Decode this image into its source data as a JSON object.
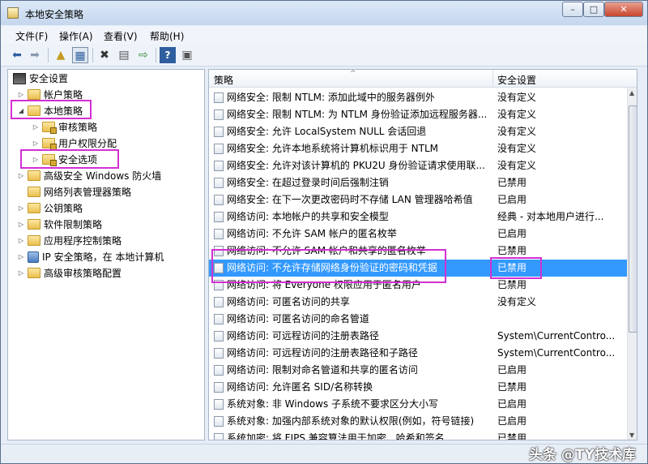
{
  "window": {
    "title": "本地安全策略",
    "min_label": "–",
    "max_label": "□",
    "close_label": "✕"
  },
  "menu": [
    {
      "label": "文件(F)"
    },
    {
      "label": "操作(A)"
    },
    {
      "label": "查看(V)"
    },
    {
      "label": "帮助(H)"
    }
  ],
  "toolbar": [
    "back-icon",
    "forward-icon",
    "up-folder-icon",
    "show-hide-tree-icon",
    "delete-icon",
    "properties-icon",
    "export-list-icon",
    "help-icon",
    "console-icon"
  ],
  "tree": {
    "root": "安全设置",
    "items": [
      {
        "label": "帐户策略"
      },
      {
        "label": "本地策略"
      },
      {
        "label": "审核策略"
      },
      {
        "label": "用户权限分配"
      },
      {
        "label": "安全选项"
      },
      {
        "label": "高级安全 Windows 防火墙"
      },
      {
        "label": "网络列表管理器策略"
      },
      {
        "label": "公钥策略"
      },
      {
        "label": "软件限制策略"
      },
      {
        "label": "应用程序控制策略"
      },
      {
        "label": "IP 安全策略，在 本地计算机"
      },
      {
        "label": "高级审核策略配置"
      }
    ]
  },
  "table": {
    "col_policy": "策略",
    "col_setting": "安全设置",
    "rows": [
      {
        "policy": "网络安全: 限制 NTLM: 添加此域中的服务器例外",
        "setting": "没有定义"
      },
      {
        "policy": "网络安全: 限制 NTLM: 为 NTLM 身份验证添加远程服务器...",
        "setting": "没有定义"
      },
      {
        "policy": "网络安全: 允许 LocalSystem NULL 会话回退",
        "setting": "没有定义"
      },
      {
        "policy": "网络安全: 允许本地系统将计算机标识用于 NTLM",
        "setting": "没有定义"
      },
      {
        "policy": "网络安全: 允许对该计算机的 PKU2U 身份验证请求使用联...",
        "setting": "没有定义"
      },
      {
        "policy": "网络安全: 在超过登录时间后强制注销",
        "setting": "已禁用"
      },
      {
        "policy": "网络安全: 在下一次更改密码时不存储 LAN 管理器哈希值",
        "setting": "已启用"
      },
      {
        "policy": "网络访问: 本地帐户的共享和安全模型",
        "setting": "经典 - 对本地用户进行..."
      },
      {
        "policy": "网络访问: 不允许 SAM 帐户的匿名枚举",
        "setting": "已启用"
      },
      {
        "policy": "网络访问: 不允许 SAM 帐户和共享的匿名枚举",
        "setting": "已禁用"
      },
      {
        "policy": "网络访问: 不允许存储网络身份验证的密码和凭据",
        "setting": "已禁用"
      },
      {
        "policy": "网络访问: 将 Everyone 权限应用于匿名用户",
        "setting": "已禁用"
      },
      {
        "policy": "网络访问: 可匿名访问的共享",
        "setting": "没有定义"
      },
      {
        "policy": "网络访问: 可匿名访问的命名管道",
        "setting": ""
      },
      {
        "policy": "网络访问: 可远程访问的注册表路径",
        "setting": "System\\CurrentContro..."
      },
      {
        "policy": "网络访问: 可远程访问的注册表路径和子路径",
        "setting": "System\\CurrentContro..."
      },
      {
        "policy": "网络访问: 限制对命名管道和共享的匿名访问",
        "setting": "已启用"
      },
      {
        "policy": "网络访问: 允许匿名 SID/名称转换",
        "setting": "已禁用"
      },
      {
        "policy": "系统对象: 非 Windows 子系统不要求区分大小写",
        "setting": "已启用"
      },
      {
        "policy": "系统对象: 加强内部系统对象的默认权限(例如，符号链接)",
        "setting": "已启用"
      },
      {
        "policy": "系统加密: 将 FIPS 兼容算法用于加密、哈希和签名",
        "setting": "已禁用"
      }
    ],
    "selected_index": 10
  },
  "watermark": "头条 @TY技术库",
  "colors": {
    "selection": "#3399ff",
    "highlight_box": "#d32fd3"
  }
}
